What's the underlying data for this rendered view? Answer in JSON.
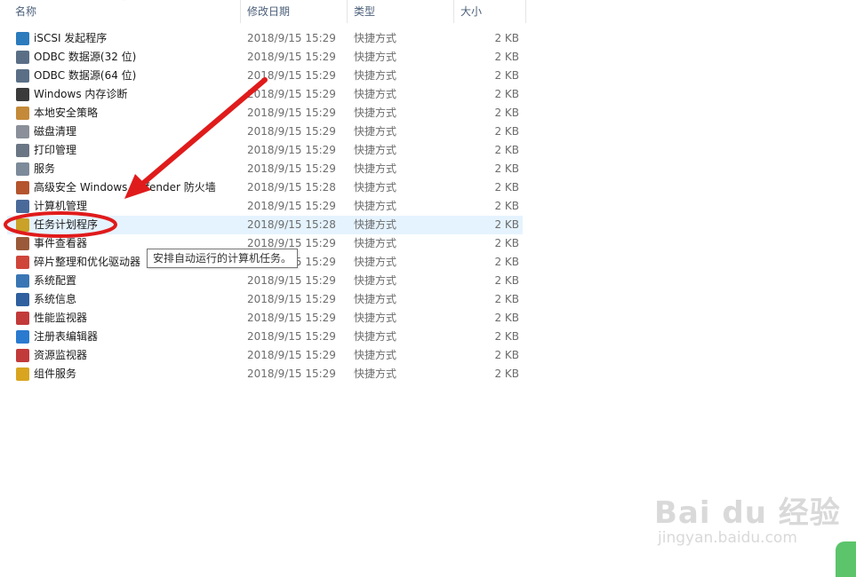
{
  "columns": {
    "name": "名称",
    "date": "修改日期",
    "type": "类型",
    "size": "大小"
  },
  "rows": [
    {
      "name": "iSCSI 发起程序",
      "date": "2018/9/15 15:29",
      "type": "快捷方式",
      "size": "2 KB",
      "icon": "iscsi-globe-icon",
      "color": "#2b7bbd"
    },
    {
      "name": "ODBC 数据源(32 位)",
      "date": "2018/9/15 15:29",
      "type": "快捷方式",
      "size": "2 KB",
      "icon": "odbc-database-icon",
      "color": "#5a6f86"
    },
    {
      "name": "ODBC 数据源(64 位)",
      "date": "2018/9/15 15:29",
      "type": "快捷方式",
      "size": "2 KB",
      "icon": "odbc-database-icon",
      "color": "#5a6f86"
    },
    {
      "name": "Windows 内存诊断",
      "date": "2018/9/15 15:29",
      "type": "快捷方式",
      "size": "2 KB",
      "icon": "memory-chip-icon",
      "color": "#3a3a3a"
    },
    {
      "name": "本地安全策略",
      "date": "2018/9/15 15:29",
      "type": "快捷方式",
      "size": "2 KB",
      "icon": "security-policy-icon",
      "color": "#c48a3a"
    },
    {
      "name": "磁盘清理",
      "date": "2018/9/15 15:29",
      "type": "快捷方式",
      "size": "2 KB",
      "icon": "disk-cleanup-icon",
      "color": "#8a8f99"
    },
    {
      "name": "打印管理",
      "date": "2018/9/15 15:29",
      "type": "快捷方式",
      "size": "2 KB",
      "icon": "printer-icon",
      "color": "#6b7684"
    },
    {
      "name": "服务",
      "date": "2018/9/15 15:29",
      "type": "快捷方式",
      "size": "2 KB",
      "icon": "gear-icon",
      "color": "#7c8a9a"
    },
    {
      "name": "高级安全 Windows Defender 防火墙",
      "date": "2018/9/15 15:28",
      "type": "快捷方式",
      "size": "2 KB",
      "icon": "firewall-icon",
      "color": "#b4552e"
    },
    {
      "name": "计算机管理",
      "date": "2018/9/15 15:29",
      "type": "快捷方式",
      "size": "2 KB",
      "icon": "computer-management-icon",
      "color": "#4a6a9a"
    },
    {
      "name": "任务计划程序",
      "date": "2018/9/15 15:28",
      "type": "快捷方式",
      "size": "2 KB",
      "icon": "clock-icon",
      "color": "#c9a227"
    },
    {
      "name": "事件查看器",
      "date": "2018/9/15 15:29",
      "type": "快捷方式",
      "size": "2 KB",
      "icon": "event-viewer-icon",
      "color": "#9a5a3a"
    },
    {
      "name": "碎片整理和优化驱动器",
      "date": "2018/9/15 15:29",
      "type": "快捷方式",
      "size": "2 KB",
      "icon": "defrag-icon",
      "color": "#d0453a"
    },
    {
      "name": "系统配置",
      "date": "2018/9/15 15:29",
      "type": "快捷方式",
      "size": "2 KB",
      "icon": "system-config-icon",
      "color": "#3a76b5"
    },
    {
      "name": "系统信息",
      "date": "2018/9/15 15:29",
      "type": "快捷方式",
      "size": "2 KB",
      "icon": "system-info-icon",
      "color": "#2f5f9e"
    },
    {
      "name": "性能监视器",
      "date": "2018/9/15 15:29",
      "type": "快捷方式",
      "size": "2 KB",
      "icon": "performance-monitor-icon",
      "color": "#c23a3a"
    },
    {
      "name": "注册表编辑器",
      "date": "2018/9/15 15:29",
      "type": "快捷方式",
      "size": "2 KB",
      "icon": "registry-editor-icon",
      "color": "#2a7ad0"
    },
    {
      "name": "资源监视器",
      "date": "2018/9/15 15:29",
      "type": "快捷方式",
      "size": "2 KB",
      "icon": "resource-monitor-icon",
      "color": "#c23a3a"
    },
    {
      "name": "组件服务",
      "date": "2018/9/15 15:29",
      "type": "快捷方式",
      "size": "2 KB",
      "icon": "component-services-icon",
      "color": "#d9a520"
    }
  ],
  "selected_row_index": 10,
  "tooltip": "安排自动运行的计算机任务。",
  "annotation_color": "#e01b1b",
  "watermark": {
    "main": "Bai du 经验",
    "sub": "jingyan.baidu.com"
  }
}
